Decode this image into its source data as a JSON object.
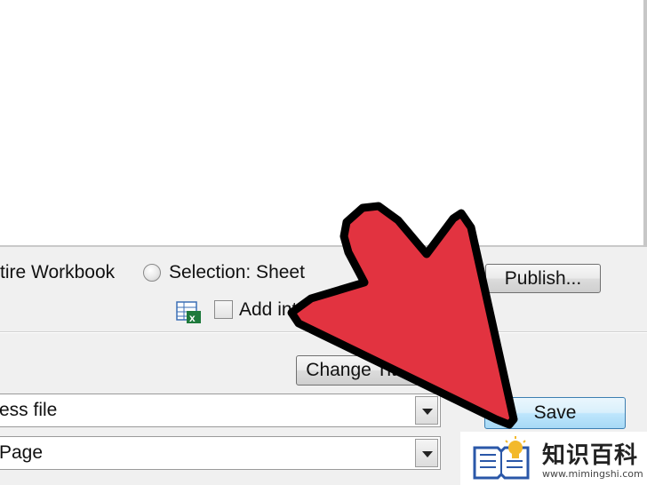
{
  "options": {
    "entire_workbook_label": "tire Workbook",
    "selection_label": "Selection: Sheet",
    "add_interactivity_label": "Add interactivity"
  },
  "buttons": {
    "publish": "Publish...",
    "change_title": "Change Title...",
    "save": "Save"
  },
  "fields": {
    "file_name_value": "ess file",
    "save_as_type_value": "Page"
  },
  "watermark": {
    "name": "知识百科",
    "url": "www.mimingshi.com"
  },
  "colors": {
    "arrow_fill": "#e23340",
    "arrow_outline": "#000000",
    "save_button_accent": "#3c7fb1"
  },
  "icons": {
    "excel_sheet": "excel-sheet-icon",
    "book_bulb_logo": "book-bulb-icon",
    "dropdown": "chevron-down-icon"
  }
}
